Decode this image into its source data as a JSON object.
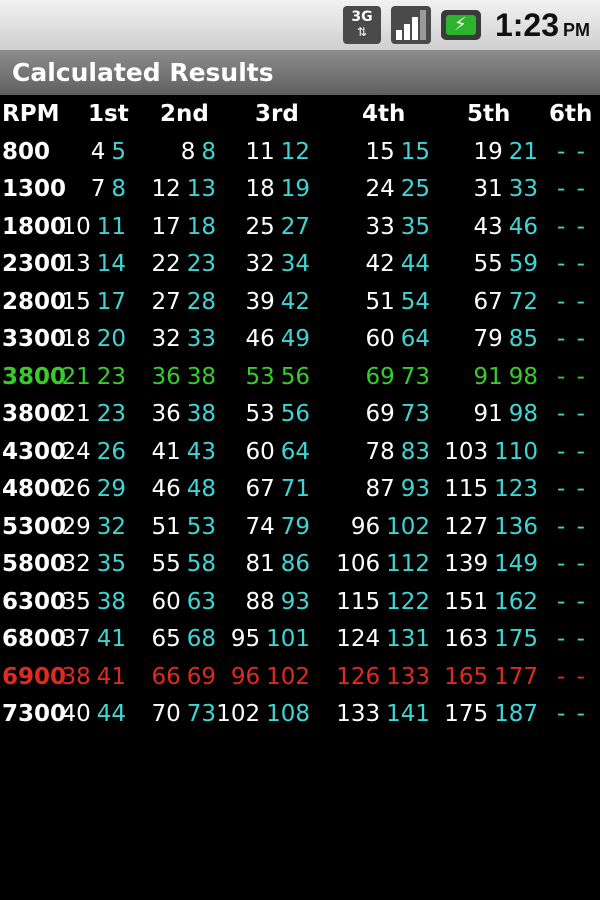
{
  "status_bar": {
    "network_label": "3G",
    "network_arrows": "⇅",
    "time": "1:23",
    "ampm": "PM",
    "icons": [
      "3g-network-icon",
      "signal-strength-icon",
      "battery-charging-icon"
    ]
  },
  "title": "Calculated Results",
  "colors": {
    "primary_value": "#ffffff",
    "secondary_value": "#3fd5d5",
    "highlight_green": "#37cc2b",
    "highlight_red": "#e02a1f",
    "background": "#000000"
  },
  "table": {
    "headers": [
      "RPM",
      "1st",
      "2nd",
      "3rd",
      "4th",
      "5th",
      "6th"
    ],
    "rows": [
      {
        "rpm": "800",
        "style": "normal",
        "gears": [
          [
            "4",
            "5"
          ],
          [
            "8",
            "8"
          ],
          [
            "11",
            "12"
          ],
          [
            "15",
            "15"
          ],
          [
            "19",
            "21"
          ]
        ],
        "sixth": "- -"
      },
      {
        "rpm": "1300",
        "style": "normal",
        "gears": [
          [
            "7",
            "8"
          ],
          [
            "12",
            "13"
          ],
          [
            "18",
            "19"
          ],
          [
            "24",
            "25"
          ],
          [
            "31",
            "33"
          ]
        ],
        "sixth": "- -"
      },
      {
        "rpm": "1800",
        "style": "normal",
        "gears": [
          [
            "10",
            "11"
          ],
          [
            "17",
            "18"
          ],
          [
            "25",
            "27"
          ],
          [
            "33",
            "35"
          ],
          [
            "43",
            "46"
          ]
        ],
        "sixth": "- -"
      },
      {
        "rpm": "2300",
        "style": "normal",
        "gears": [
          [
            "13",
            "14"
          ],
          [
            "22",
            "23"
          ],
          [
            "32",
            "34"
          ],
          [
            "42",
            "44"
          ],
          [
            "55",
            "59"
          ]
        ],
        "sixth": "- -"
      },
      {
        "rpm": "2800",
        "style": "normal",
        "gears": [
          [
            "15",
            "17"
          ],
          [
            "27",
            "28"
          ],
          [
            "39",
            "42"
          ],
          [
            "51",
            "54"
          ],
          [
            "67",
            "72"
          ]
        ],
        "sixth": "- -"
      },
      {
        "rpm": "3300",
        "style": "normal",
        "gears": [
          [
            "18",
            "20"
          ],
          [
            "32",
            "33"
          ],
          [
            "46",
            "49"
          ],
          [
            "60",
            "64"
          ],
          [
            "79",
            "85"
          ]
        ],
        "sixth": "- -"
      },
      {
        "rpm": "3800",
        "style": "green",
        "gears": [
          [
            "21",
            "23"
          ],
          [
            "36",
            "38"
          ],
          [
            "53",
            "56"
          ],
          [
            "69",
            "73"
          ],
          [
            "91",
            "98"
          ]
        ],
        "sixth": "- -"
      },
      {
        "rpm": "3800",
        "style": "normal",
        "gears": [
          [
            "21",
            "23"
          ],
          [
            "36",
            "38"
          ],
          [
            "53",
            "56"
          ],
          [
            "69",
            "73"
          ],
          [
            "91",
            "98"
          ]
        ],
        "sixth": "- -"
      },
      {
        "rpm": "4300",
        "style": "normal",
        "gears": [
          [
            "24",
            "26"
          ],
          [
            "41",
            "43"
          ],
          [
            "60",
            "64"
          ],
          [
            "78",
            "83"
          ],
          [
            "103",
            "110"
          ]
        ],
        "sixth": "- -"
      },
      {
        "rpm": "4800",
        "style": "normal",
        "gears": [
          [
            "26",
            "29"
          ],
          [
            "46",
            "48"
          ],
          [
            "67",
            "71"
          ],
          [
            "87",
            "93"
          ],
          [
            "115",
            "123"
          ]
        ],
        "sixth": "- -"
      },
      {
        "rpm": "5300",
        "style": "normal",
        "gears": [
          [
            "29",
            "32"
          ],
          [
            "51",
            "53"
          ],
          [
            "74",
            "79"
          ],
          [
            "96",
            "102"
          ],
          [
            "127",
            "136"
          ]
        ],
        "sixth": "- -"
      },
      {
        "rpm": "5800",
        "style": "normal",
        "gears": [
          [
            "32",
            "35"
          ],
          [
            "55",
            "58"
          ],
          [
            "81",
            "86"
          ],
          [
            "106",
            "112"
          ],
          [
            "139",
            "149"
          ]
        ],
        "sixth": "- -"
      },
      {
        "rpm": "6300",
        "style": "normal",
        "gears": [
          [
            "35",
            "38"
          ],
          [
            "60",
            "63"
          ],
          [
            "88",
            "93"
          ],
          [
            "115",
            "122"
          ],
          [
            "151",
            "162"
          ]
        ],
        "sixth": "- -"
      },
      {
        "rpm": "6800",
        "style": "normal",
        "gears": [
          [
            "37",
            "41"
          ],
          [
            "65",
            "68"
          ],
          [
            "95",
            "101"
          ],
          [
            "124",
            "131"
          ],
          [
            "163",
            "175"
          ]
        ],
        "sixth": "- -"
      },
      {
        "rpm": "6900",
        "style": "red",
        "gears": [
          [
            "38",
            "41"
          ],
          [
            "66",
            "69"
          ],
          [
            "96",
            "102"
          ],
          [
            "126",
            "133"
          ],
          [
            "165",
            "177"
          ]
        ],
        "sixth": "- -"
      },
      {
        "rpm": "7300",
        "style": "normal",
        "gears": [
          [
            "40",
            "44"
          ],
          [
            "70",
            "73"
          ],
          [
            "102",
            "108"
          ],
          [
            "133",
            "141"
          ],
          [
            "175",
            "187"
          ]
        ],
        "sixth": "- -"
      }
    ]
  }
}
